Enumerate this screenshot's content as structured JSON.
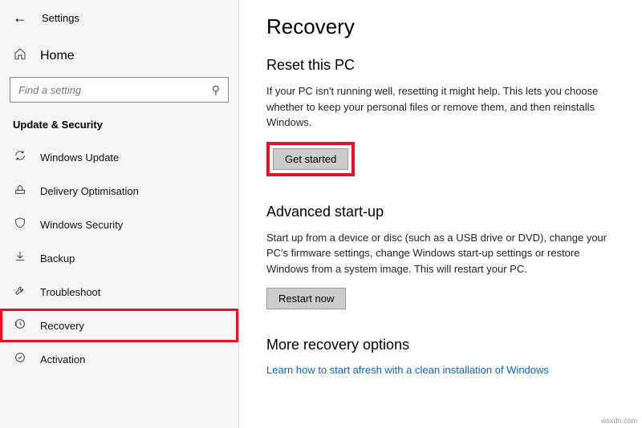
{
  "header": {
    "title": "Settings"
  },
  "home": {
    "label": "Home"
  },
  "search": {
    "placeholder": "Find a setting"
  },
  "category": "Update & Security",
  "nav": [
    {
      "label": "Windows Update"
    },
    {
      "label": "Delivery Optimisation"
    },
    {
      "label": "Windows Security"
    },
    {
      "label": "Backup"
    },
    {
      "label": "Troubleshoot"
    },
    {
      "label": "Recovery"
    },
    {
      "label": "Activation"
    }
  ],
  "page": {
    "title": "Recovery",
    "reset": {
      "heading": "Reset this PC",
      "body": "If your PC isn't running well, resetting it might help. This lets you choose whether to keep your personal files or remove them, and then reinstalls Windows.",
      "button": "Get started"
    },
    "advanced": {
      "heading": "Advanced start-up",
      "body": "Start up from a device or disc (such as a USB drive or DVD), change your PC's firmware settings, change Windows start-up settings or restore Windows from a system image. This will restart your PC.",
      "button": "Restart now"
    },
    "more": {
      "heading": "More recovery options",
      "link": "Learn how to start afresh with a clean installation of Windows"
    }
  },
  "watermark": "wsxdn.com"
}
